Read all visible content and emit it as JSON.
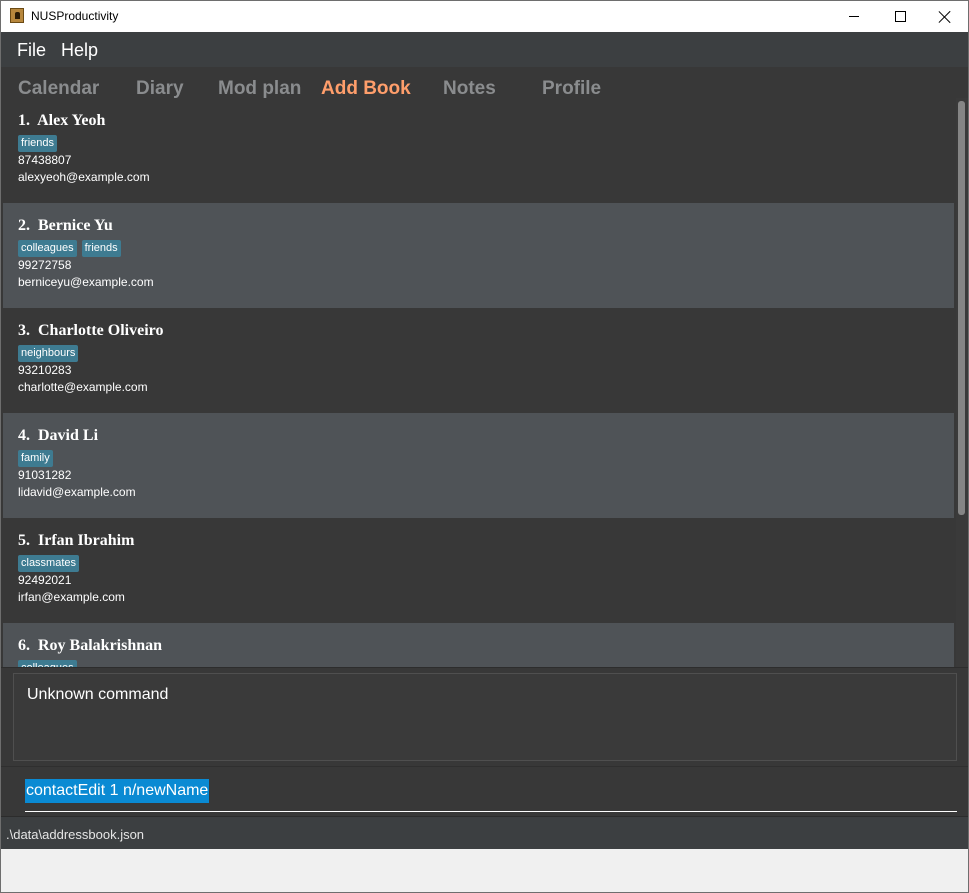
{
  "window": {
    "title": "NUSProductivity"
  },
  "menu": {
    "items": [
      "File",
      "Help"
    ]
  },
  "tabs": [
    {
      "label": "Calendar",
      "active": false
    },
    {
      "label": "Diary",
      "active": false
    },
    {
      "label": "Mod plan",
      "active": false
    },
    {
      "label": "Add Book",
      "active": true
    },
    {
      "label": "Notes",
      "active": false
    },
    {
      "label": "Profile",
      "active": false
    }
  ],
  "contacts": [
    {
      "name": "1.  Alex Yeoh",
      "tags": [
        "friends"
      ],
      "phone": "87438807",
      "email": "alexyeoh@example.com"
    },
    {
      "name": "2.  Bernice Yu",
      "tags": [
        "colleagues",
        "friends"
      ],
      "phone": "99272758",
      "email": "berniceyu@example.com"
    },
    {
      "name": "3.  Charlotte Oliveiro",
      "tags": [
        "neighbours"
      ],
      "phone": "93210283",
      "email": "charlotte@example.com"
    },
    {
      "name": "4.  David Li",
      "tags": [
        "family"
      ],
      "phone": "91031282",
      "email": "lidavid@example.com"
    },
    {
      "name": "5.  Irfan Ibrahim",
      "tags": [
        "classmates"
      ],
      "phone": "92492021",
      "email": "irfan@example.com"
    },
    {
      "name": "6.  Roy Balakrishnan",
      "tags": [
        "colleagues"
      ],
      "phone": "",
      "email": ""
    }
  ],
  "result": {
    "text": "Unknown command"
  },
  "command": {
    "value": "contactEdit 1 n/newName"
  },
  "status": {
    "path": ".\\data\\addressbook.json"
  },
  "colors": {
    "active_tab": "#ff9e6b",
    "tag": "#3e7b91",
    "selection": "#0a8ad3"
  }
}
